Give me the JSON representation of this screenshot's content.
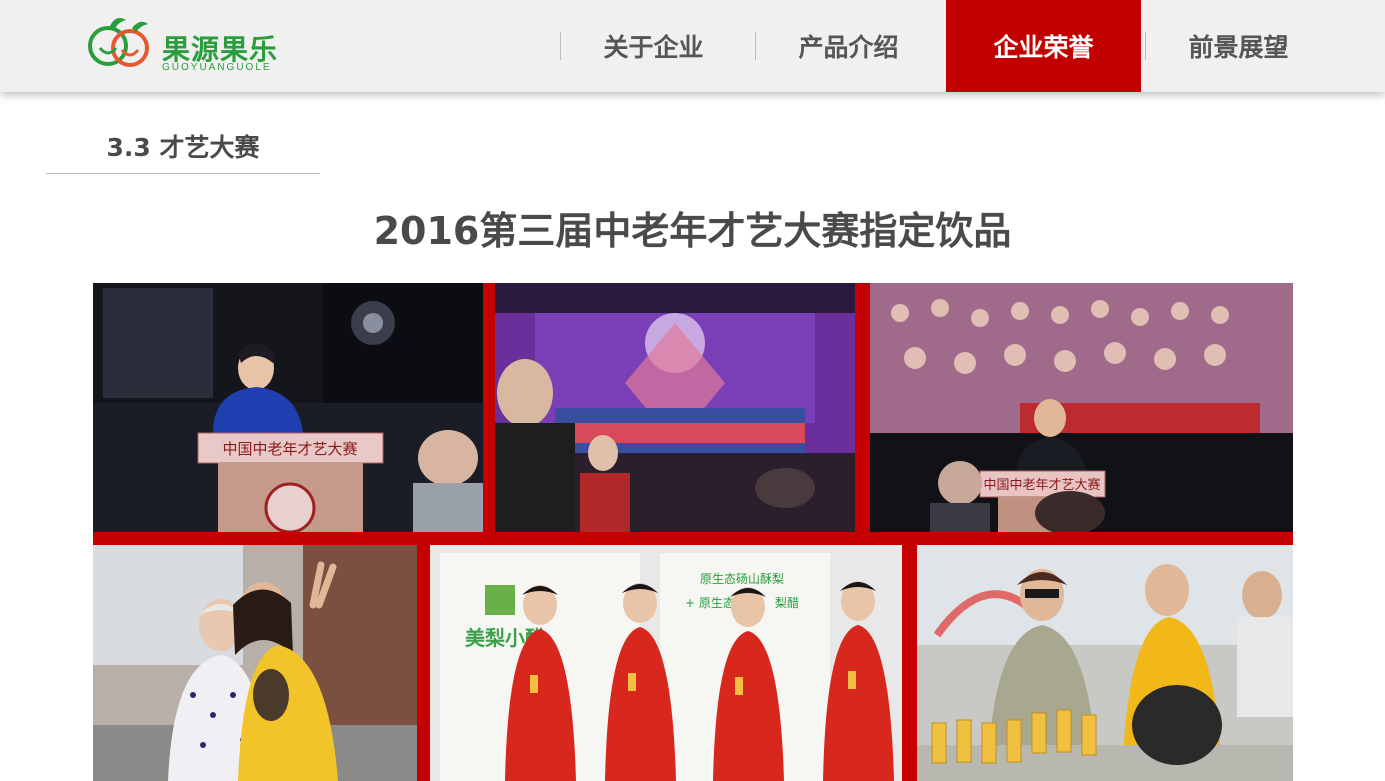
{
  "header": {
    "logo": {
      "brand_cn": "果源果乐",
      "brand_en": "GUOYUANGUOLE"
    },
    "nav": [
      {
        "label": "关于企业",
        "active": false
      },
      {
        "label": "产品介绍",
        "active": false
      },
      {
        "label": "企业荣誉",
        "active": true
      },
      {
        "label": "前景展望",
        "active": false
      }
    ]
  },
  "section": {
    "title": "3.3 才艺大赛"
  },
  "main": {
    "title": "2016第三届中老年才艺大赛指定饮品"
  },
  "photos": {
    "podium_sign_1": "中国中老年才艺大赛",
    "podium_sign_2": "中国中老年才艺大赛",
    "poster_text_1": "原生态砀山酥梨",
    "poster_text_2": "+ 原生态",
    "poster_text_3": "梨醋",
    "poster_text_4": "美梨小醋"
  },
  "colors": {
    "accent": "#c30000",
    "brand_green": "#2a9d3c",
    "text_dark": "#4a4a4a"
  }
}
